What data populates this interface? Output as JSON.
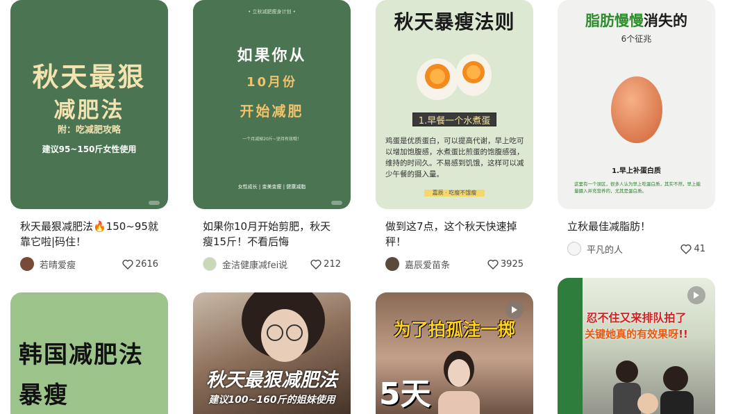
{
  "colors": {
    "green_dark": "#4a7452",
    "green_light": "#9cc48a",
    "cream": "#f3e3b0",
    "orange": "#f2c36a"
  },
  "cards": [
    {
      "cover": {
        "line1": "秋天最狠",
        "line2": "减肥法",
        "line3": "附：吃减肥攻略",
        "line4": "建议95~150斤女性使用"
      },
      "title": "秋天最狠减肥法🔥150~95就靠它啦|码住！",
      "author": "若晴爱瘦",
      "likes": "2616",
      "icon": "heart-icon"
    },
    {
      "cover": {
        "top": "• 立秋减肥瘦身计划 •",
        "line1": "如果你从",
        "line2": "10月份",
        "line3": "开始减肥",
        "small": "一个月减掉20斤~坚持有效哦！",
        "footer": "女性成长 | 变美变瘦 | 健康减脂"
      },
      "title": "如果你10月开始剪肥，秋天瘦15斤！不看后悔",
      "author": "金洁健康减fei说",
      "likes": "212",
      "icon": "heart-icon"
    },
    {
      "cover": {
        "heading": "秋天暴瘦法则",
        "step": "1.早餐一个水煮蛋",
        "body": "鸡蛋是优质蛋白，可以提高代谢，早上吃可以增加饱腹感，水煮蛋比煎蛋的饱腹感强，维持的时间久。不易感到饥饿，这样可以减少午餐的摄入量。",
        "tag": "嘉辰 · 吃瘦不饿瘦"
      },
      "title": "做到这7点，这个秋天快速掉秤！",
      "author": "嘉辰爱苗条",
      "likes": "3925",
      "icon": "heart-icon"
    },
    {
      "cover": {
        "heading_green": "脂肪慢慢",
        "heading_rest": "消失的",
        "sub": "6个征兆",
        "step": "1.早上补蛋白质",
        "body": "这里有一个误区，很多人认为早上吃蛋白质，其实不然，早上能量摄入并充营养的，尤其是蛋白质。"
      },
      "title": "立秋最佳减脂肪！",
      "author": "平凡的人",
      "likes": "41",
      "icon": "heart-icon"
    },
    {
      "cover": {
        "line1": "韩国减肥法",
        "line2": "暴瘦"
      }
    },
    {
      "cover": {
        "line1": "秋天最狠减肥法",
        "line2": "建议100~160斤的姐妹使用"
      }
    },
    {
      "cover": {
        "line1": "为了拍孤注一掷",
        "line2": "5天"
      },
      "icon": "play-icon"
    },
    {
      "cover": {
        "line1": "忍不住又来排队拍了",
        "line2": "关键她真的有效果呀",
        "accent": "!!"
      },
      "icon": "play-icon"
    }
  ]
}
